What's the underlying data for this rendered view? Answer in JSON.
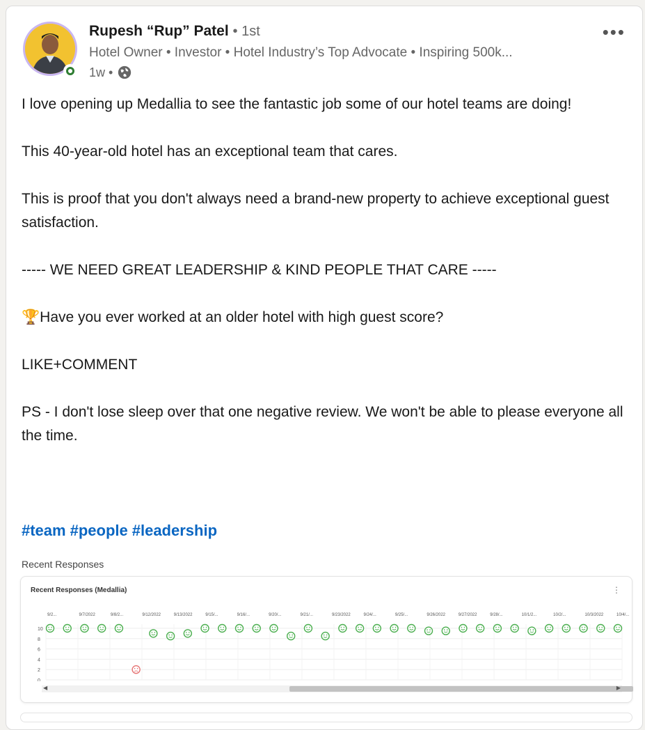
{
  "author": {
    "name": "Rupesh “Rup” Patel",
    "degree": "• 1st",
    "headline": "Hotel Owner • Investor • Hotel Industry’s Top Advocate • Inspiring 500k...",
    "time": "1w •"
  },
  "post": {
    "lines": [
      "I love opening up Medallia to see the fantastic job some of our hotel teams are doing!",
      "",
      "This 40-year-old hotel has an exceptional team that cares.",
      "",
      "This is proof that you don't always need a brand-new property to achieve exceptional guest satisfaction.",
      "",
      "----- WE NEED GREAT LEADERSHIP & KIND PEOPLE THAT CARE -----",
      "",
      "🏆Have you ever worked at an older hotel with high guest score?",
      "",
      "LIKE+COMMENT",
      "",
      "PS - I don't lose sleep over that one negative review. We won't be able to please everyone all the time."
    ],
    "hashtags": [
      "#team",
      "#people",
      "#leadership"
    ]
  },
  "embed": {
    "caption": "Recent Responses",
    "card_title": "Recent Responses (Medallia)",
    "more_icon": "⋮"
  },
  "chart_data": {
    "type": "scatter",
    "title": "Recent Responses (Medallia)",
    "xlabel": "",
    "ylabel": "",
    "ylim": [
      0,
      10
    ],
    "y_ticks": [
      "10",
      "8",
      "6",
      "4",
      "2",
      "0"
    ],
    "x_tick_labels": [
      "9/2...",
      "9/7/2022",
      "9/8/2...",
      "9/12/2022",
      "9/13/2022",
      "9/15/...",
      "9/16/...",
      "9/20/...",
      "9/21/...",
      "9/23/2022",
      "9/24/...",
      "9/25/...",
      "9/26/2022",
      "9/27/2022",
      "9/28/...",
      "10/1/2...",
      "10/2/...",
      "10/3/2022",
      "10/4/..."
    ],
    "points": [
      10,
      10,
      10,
      10,
      10,
      2,
      9,
      8.5,
      9,
      10,
      10,
      10,
      10,
      10,
      8.5,
      10,
      8.5,
      10,
      10,
      10,
      10,
      10,
      9.5,
      9.5,
      10,
      10,
      10,
      10,
      9.5,
      10,
      10,
      10,
      10,
      10
    ],
    "colors": {
      "positive": "#4caf50",
      "negative": "#e57373"
    }
  }
}
